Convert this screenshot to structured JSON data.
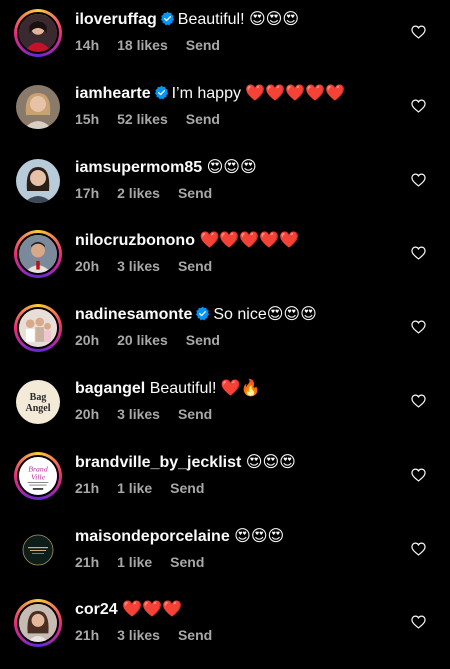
{
  "comments": [
    {
      "username": "iloveruffag",
      "verified": true,
      "text": "Beautiful! 😍😍😍",
      "time": "14h",
      "likes": "18 likes",
      "reply": "Send",
      "avatar": "woman-red-dress",
      "story": true
    },
    {
      "username": "iamhearte",
      "verified": true,
      "text": "I’m happy ❤️❤️❤️❤️❤️",
      "time": "15h",
      "likes": "52 likes",
      "reply": "Send",
      "avatar": "woman-blonde",
      "story": false
    },
    {
      "username": "iamsupermom85",
      "verified": false,
      "text": "😍😍😍",
      "time": "17h",
      "likes": "2 likes",
      "reply": "Send",
      "avatar": "woman-dark-hair",
      "story": false
    },
    {
      "username": "nilocruzbonono",
      "verified": false,
      "text": "❤️❤️❤️❤️❤️",
      "time": "20h",
      "likes": "3 likes",
      "reply": "Send",
      "avatar": "man-portrait",
      "story": true
    },
    {
      "username": "nadinesamonte",
      "verified": true,
      "text": "So nice😍😍😍",
      "time": "20h",
      "likes": "20 likes",
      "reply": "Send",
      "avatar": "family-photo",
      "story": true
    },
    {
      "username": "bagangel",
      "verified": false,
      "text": "Beautiful! ❤️🔥",
      "time": "20h",
      "likes": "3 likes",
      "reply": "Send",
      "avatar": "bag-angel-logo",
      "avatar_text": "Bag Angel",
      "story": false
    },
    {
      "username": "brandville_by_jecklist",
      "verified": false,
      "text": "😍😍😍",
      "time": "21h",
      "likes": "1 like",
      "reply": "Send",
      "avatar": "brandville-logo",
      "avatar_text": "Brand Ville",
      "story": true
    },
    {
      "username": "maisondeporcelaine",
      "verified": false,
      "text": "😍😍😍",
      "time": "21h",
      "likes": "1 like",
      "reply": "Send",
      "avatar": "maison-logo",
      "story": false
    },
    {
      "username": "cor24",
      "verified": false,
      "text": "❤️❤️❤️",
      "time": "21h",
      "likes": "3 likes",
      "reply": "Send",
      "avatar": "woman-portrait",
      "story": true
    }
  ],
  "colors": {
    "background": "#000000",
    "verified_badge": "#0095f6",
    "meta_text": "#a8a8a8"
  },
  "icons": {
    "verified": "verified-badge-icon",
    "like": "heart-outline-icon"
  }
}
